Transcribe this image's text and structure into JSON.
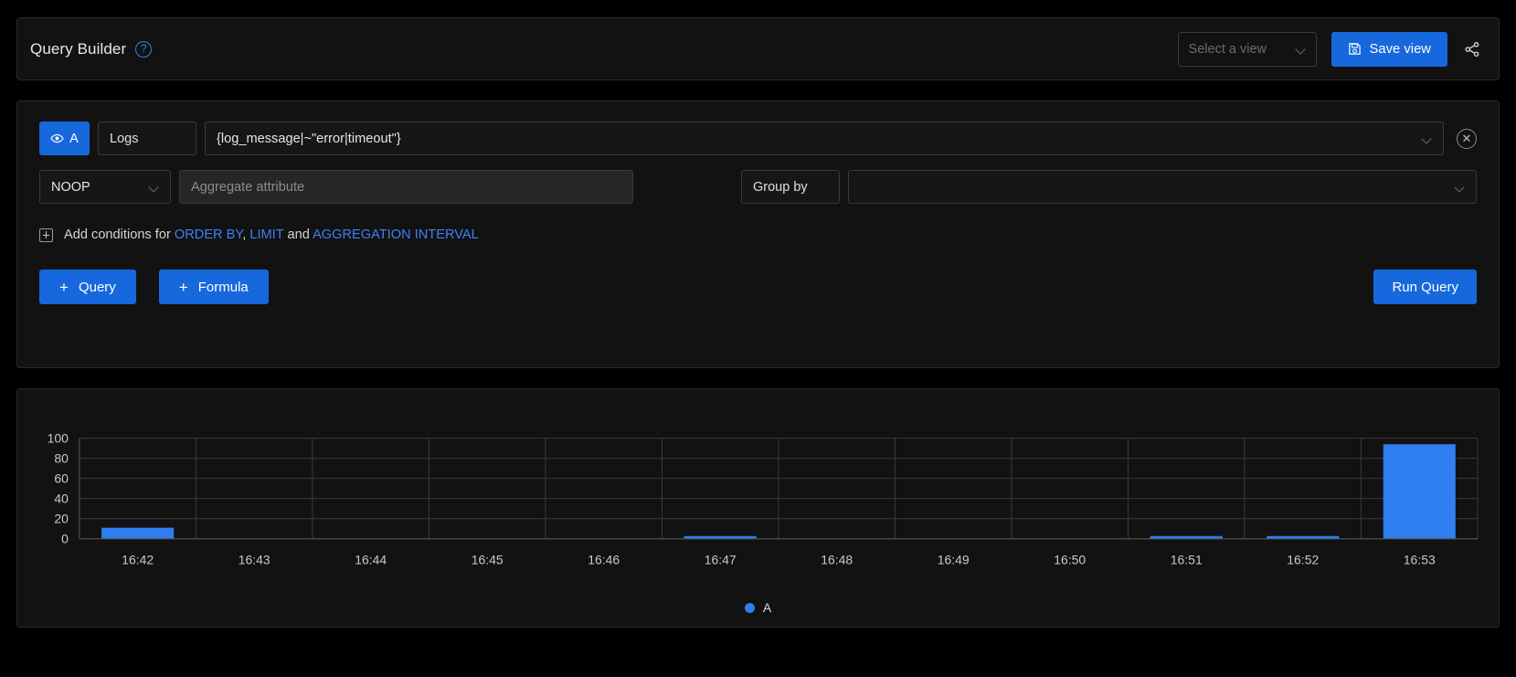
{
  "header": {
    "title": "Query Builder",
    "help_icon": "help-circle-icon",
    "select_view_placeholder": "Select a view",
    "save_view_label": "Save view",
    "share_icon": "share-icon"
  },
  "builder": {
    "query_letter": "A",
    "visibility_icon": "eye-icon",
    "data_source": "Logs",
    "query_expression": "{log_message|~\"error|timeout\"}",
    "delete_icon": "close-circle-icon",
    "aggregate_function": "NOOP",
    "aggregate_attribute_placeholder": "Aggregate attribute",
    "group_by_label": "Group by",
    "group_by_value": "",
    "conditions": {
      "expand_icon": "plus-box-icon",
      "prefix": "Add conditions for",
      "link_order_by": "ORDER BY",
      "separator_comma": ",",
      "link_limit": "LIMIT",
      "conjunction": "and",
      "link_aggregation_interval": "AGGREGATION INTERVAL"
    },
    "add_query_label": "Query",
    "add_formula_label": "Formula",
    "add_plus": "+",
    "run_query_label": "Run Query"
  },
  "chart_data": {
    "type": "bar",
    "title": "",
    "xlabel": "",
    "ylabel": "",
    "categories": [
      "16:42",
      "16:43",
      "16:44",
      "16:45",
      "16:46",
      "16:47",
      "16:48",
      "16:49",
      "16:50",
      "16:51",
      "16:52",
      "16:53"
    ],
    "series": [
      {
        "name": "A",
        "color": "#2f7ff0",
        "values": [
          11,
          0,
          0,
          0,
          0,
          2,
          0,
          0,
          0,
          2,
          1,
          94
        ]
      }
    ],
    "ytick_labels": [
      "100",
      "80",
      "60",
      "40",
      "20",
      "0"
    ],
    "yticks": [
      100,
      80,
      60,
      40,
      20,
      0
    ],
    "ylim": [
      0,
      100
    ],
    "grid": true,
    "legend_position": "bottom",
    "legend": [
      {
        "label": "A",
        "color": "#2f7ff0"
      }
    ]
  },
  "colors": {
    "accent": "#1668dc",
    "bar": "#2f7ff0",
    "link": "#3b82f6",
    "panel_bg": "#121212",
    "page_bg": "#000000"
  }
}
